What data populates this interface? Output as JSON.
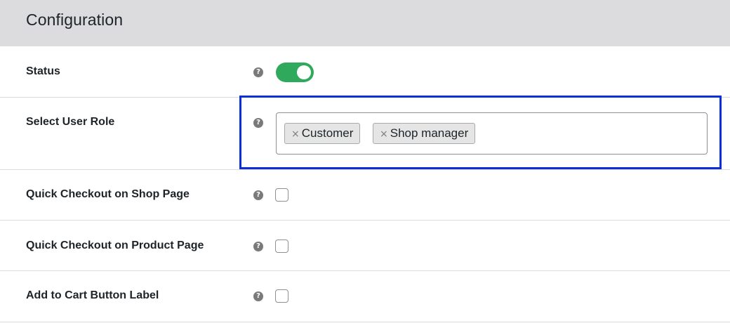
{
  "panel": {
    "title": "Configuration"
  },
  "help_glyph": "?",
  "rows": [
    {
      "label": "Status",
      "control": "toggle",
      "toggle_on": true
    },
    {
      "label": "Select User Role",
      "control": "multiselect"
    },
    {
      "label": "Quick Checkout on Shop Page",
      "control": "checkbox",
      "checked": false
    },
    {
      "label": "Quick Checkout on Product Page",
      "control": "checkbox",
      "checked": false
    },
    {
      "label": "Add to Cart Button Label",
      "control": "checkbox",
      "checked": false
    }
  ],
  "user_roles": {
    "remove_glyph": "×",
    "selected": [
      "Customer",
      "Shop manager"
    ]
  },
  "colors": {
    "toggle_on": "#2faa5d",
    "highlight": "#0a2fd9",
    "header_bg": "#dcdcde"
  },
  "icons": {
    "help": "help-circle-icon",
    "remove": "remove-x-icon"
  }
}
